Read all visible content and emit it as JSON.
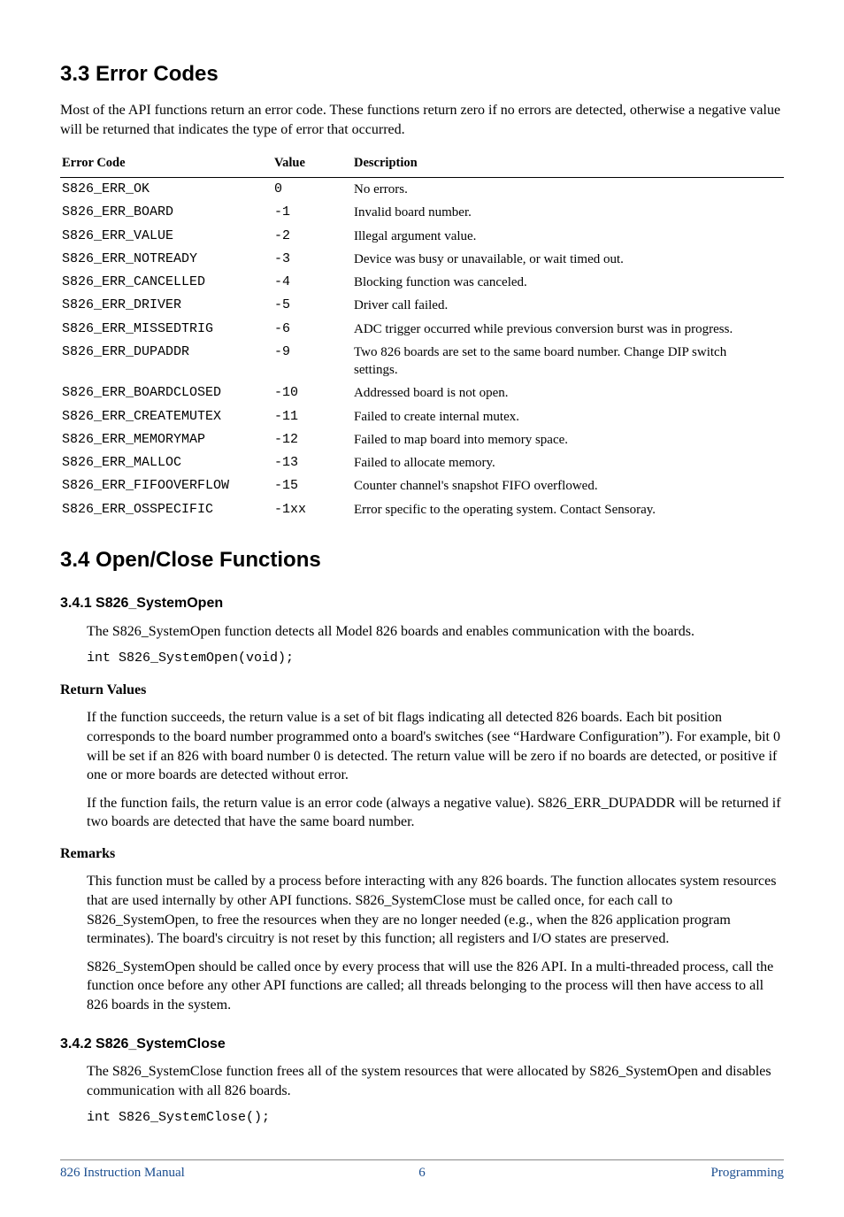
{
  "sections": {
    "s33": {
      "heading": "3.3  Error Codes",
      "intro": "Most of the API functions return an error code. These functions return zero if no errors are detected, otherwise a negative value will be returned that indicates the type of error that occurred."
    },
    "s34": {
      "heading": "3.4  Open/Close Functions"
    },
    "s341": {
      "heading": "3.4.1   S826_SystemOpen",
      "desc": "The S826_SystemOpen function detects all Model 826 boards and enables communication with the boards.",
      "code": "int S826_SystemOpen(void);",
      "ret_head": "Return Values",
      "ret_p1": "If the function succeeds, the return value is a set of bit flags indicating all detected 826 boards. Each bit position corresponds to the board number programmed onto a board's switches (see “Hardware Configuration”). For example, bit 0 will be set if an 826 with board number 0 is detected. The return value will be zero if no boards are detected, or positive if one or more boards are detected without error.",
      "ret_p2": "If the function fails, the return value is an error code (always a negative value). S826_ERR_DUPADDR will be returned if two boards are detected that have the same board number.",
      "rem_head": "Remarks",
      "rem_p1": "This function must be called by a process before interacting with any 826 boards. The function allocates system resources that are used internally by other API functions. S826_SystemClose must be called once, for each call to S826_SystemOpen, to free the resources when they are no longer needed (e.g., when the 826 application program terminates). The board's circuitry is not reset by this function; all registers and I/O states are preserved.",
      "rem_p2": "S826_SystemOpen should be called once by every process that will use the 826 API. In a multi-threaded process, call the function once before any other API functions are called; all threads belonging to the process will then have access to all 826 boards in the system."
    },
    "s342": {
      "heading": "3.4.2   S826_SystemClose",
      "desc": "The S826_SystemClose function frees all of the system resources that were allocated by S826_SystemOpen and disables communication with all 826 boards.",
      "code": "int S826_SystemClose();"
    }
  },
  "error_table": {
    "headers": {
      "code": "Error Code",
      "value": "Value",
      "desc": "Description"
    },
    "rows": [
      {
        "code": "S826_ERR_OK",
        "value": "0",
        "desc": "No errors."
      },
      {
        "code": "S826_ERR_BOARD",
        "value": "-1",
        "desc": "Invalid board number."
      },
      {
        "code": "S826_ERR_VALUE",
        "value": "-2",
        "desc": "Illegal argument value."
      },
      {
        "code": "S826_ERR_NOTREADY",
        "value": "-3",
        "desc": "Device was busy or unavailable, or wait timed out."
      },
      {
        "code": "S826_ERR_CANCELLED",
        "value": "-4",
        "desc": "Blocking function was canceled."
      },
      {
        "code": "S826_ERR_DRIVER",
        "value": "-5",
        "desc": "Driver call failed."
      },
      {
        "code": "S826_ERR_MISSEDTRIG",
        "value": "-6",
        "desc": "ADC trigger occurred while previous conversion burst was in progress."
      },
      {
        "code": "S826_ERR_DUPADDR",
        "value": "-9",
        "desc": "Two 826 boards are set to the same board number. Change DIP switch settings."
      },
      {
        "code": "S826_ERR_BOARDCLOSED",
        "value": "-10",
        "desc": "Addressed board is not open."
      },
      {
        "code": "S826_ERR_CREATEMUTEX",
        "value": "-11",
        "desc": "Failed to create internal mutex."
      },
      {
        "code": "S826_ERR_MEMORYMAP",
        "value": "-12",
        "desc": "Failed to map board into memory space."
      },
      {
        "code": "S826_ERR_MALLOC",
        "value": "-13",
        "desc": "Failed to allocate memory."
      },
      {
        "code": "S826_ERR_FIFOOVERFLOW",
        "value": "-15",
        "desc": "Counter channel's snapshot  FIFO overflowed."
      },
      {
        "code": "S826_ERR_OSSPECIFIC",
        "value": "-1xx",
        "desc": "Error specific to the operating system. Contact Sensoray."
      }
    ]
  },
  "footer": {
    "left": "826 Instruction Manual",
    "center": "6",
    "right": "Programming"
  }
}
